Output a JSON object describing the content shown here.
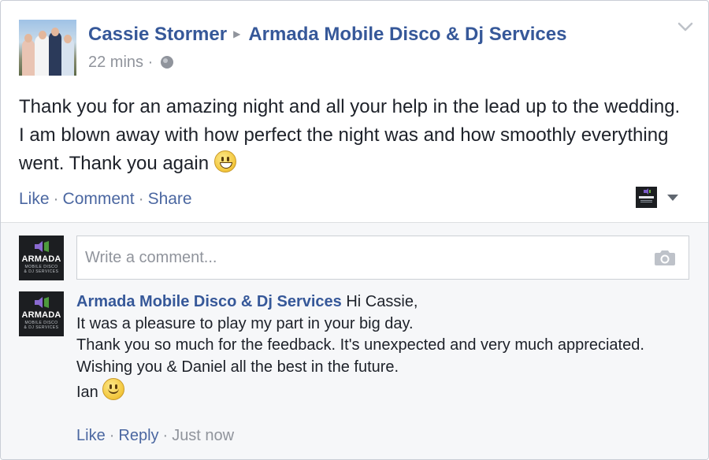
{
  "post": {
    "author": "Cassie Stormer",
    "target_page": "Armada Mobile Disco & Dj Services",
    "timestamp": "22 mins",
    "meta_separator": "·",
    "body_text": "Thank you for an amazing night and all your help in the lead up to the wedding. I am blown away with how perfect the night was and how smoothly everything went. Thank you again",
    "actions": {
      "like": "Like",
      "comment": "Comment",
      "share": "Share"
    }
  },
  "page_avatar": {
    "brand": "ARMADA",
    "brand_sub_line1": "MOBILE DISCO",
    "brand_sub_line2": "& DJ SERVICES"
  },
  "comment_input": {
    "placeholder": "Write a comment..."
  },
  "reply": {
    "commenter": "Armada Mobile Disco & Dj Services",
    "lines": [
      "Hi Cassie,",
      "It was a pleasure to play my part in your big day.",
      "Thank you so much for the feedback. It's unexpected and very much appreciated.",
      "Wishing you & Daniel all the best in the future.",
      "Ian"
    ],
    "actions": {
      "like": "Like",
      "reply": "Reply"
    },
    "timestamp": "Just now"
  },
  "icons": {
    "privacy": "globe-icon",
    "post_menu": "chevron-down-icon",
    "attach_photo": "camera-icon",
    "post_emoji": "grinning-face-emoji",
    "reply_emoji": "smiling-face-emoji"
  },
  "colors": {
    "link_blue": "#365899",
    "action_blue": "#4b67a1",
    "meta_gray": "#90949c",
    "comment_area_bg": "#f6f7f9"
  }
}
